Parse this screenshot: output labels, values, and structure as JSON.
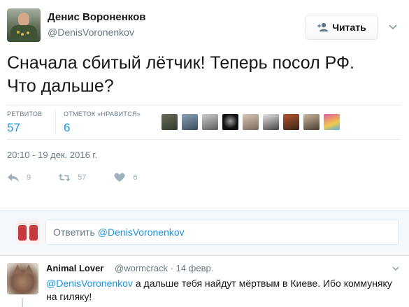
{
  "tweet": {
    "author_name": "Денис Вороненков",
    "author_handle": "@DenisVoronenkov",
    "follow_label": "Читать",
    "text_line1": "Сначала сбитый лётчик! Теперь посол РФ.",
    "text_line2": "Что дальше?",
    "stats": {
      "retweets_label": "РЕТВИТОВ",
      "retweets_value": "57",
      "likes_label": "ОТМЕТОК «НРАВИТСЯ»",
      "likes_value": "6"
    },
    "timestamp": "20:10 - 19 дек. 2016 г.",
    "actions": {
      "reply_count": "9",
      "retweet_count": "57",
      "like_count": "6"
    }
  },
  "reply_box": {
    "prefix": "Ответить ",
    "mention": "@DenisVoronenkov"
  },
  "reply": {
    "author_name": "Animal Lover",
    "meta": "@wormcrack · 14 февр.",
    "mention": "@DenisVoronenkov",
    "text": " а дальше тебя найдут мёртвым в Киеве. Ибо коммуняку на гиляку!"
  },
  "colors": {
    "link": "#1b95e0",
    "secondary_text": "#657786",
    "divider": "#e6ecf0",
    "reply_area_bg": "#f5f8fa"
  },
  "icons": [
    "follow-person-icon",
    "caret-down-icon",
    "reply-icon",
    "retweet-icon",
    "heart-icon"
  ]
}
